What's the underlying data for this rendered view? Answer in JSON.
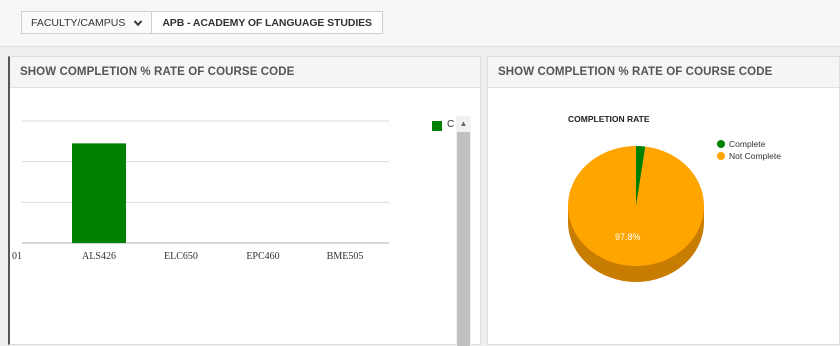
{
  "filter": {
    "label": "FACULTY/CAMPUS",
    "value": "APB - ACADEMY OF LANGUAGE STUDIES"
  },
  "left_panel": {
    "title": "SHOW COMPLETION % RATE OF COURSE CODE",
    "legend_label": "C"
  },
  "right_panel": {
    "title": "SHOW COMPLETION % RATE OF COURSE CODE",
    "pie_title": "COMPLETION RATE",
    "pie_label": "97.8%"
  },
  "chart_data": [
    {
      "type": "bar",
      "categories": [
        "01",
        "ALS426",
        "ELC650",
        "EPC460",
        "BME505"
      ],
      "series": [
        {
          "name": "C",
          "values": [
            0,
            2.45,
            0,
            0,
            0
          ]
        }
      ],
      "ylim": [
        0,
        3
      ],
      "grid": true,
      "legend": "right",
      "colors": [
        "#008000"
      ]
    },
    {
      "type": "pie",
      "title": "COMPLETION RATE",
      "labels": [
        "Complete",
        "Not Complete"
      ],
      "values": [
        2.2,
        97.8
      ],
      "colors": [
        "#008000",
        "#ffa500"
      ],
      "legend": "right"
    }
  ],
  "icons": {
    "filter_chevron": "chevron-down-icon",
    "scroll_up": "scroll-up-arrow-icon"
  }
}
